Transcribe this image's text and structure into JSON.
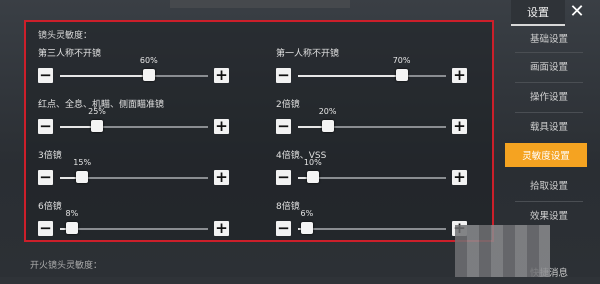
{
  "panel": {
    "title": "镜头灵敏度：",
    "settings": [
      {
        "label": "第三人称不开镜",
        "pct": "60%",
        "value": 60
      },
      {
        "label": "第一人称不开镜",
        "pct": "70%",
        "value": 70
      },
      {
        "label": "红点、全息、机瞄、侧面瞄准镜",
        "pct": "25%",
        "value": 25
      },
      {
        "label": "2倍镜",
        "pct": "20%",
        "value": 20
      },
      {
        "label": "3倍镜",
        "pct": "15%",
        "value": 15
      },
      {
        "label": "4倍镜、VSS",
        "pct": "10%",
        "value": 10
      },
      {
        "label": "6倍镜",
        "pct": "8%",
        "value": 8
      },
      {
        "label": "8倍镜",
        "pct": "6%",
        "value": 6
      }
    ]
  },
  "bottom_label": "开火镜头灵敏度：",
  "sidebar": {
    "title": "设置",
    "items": [
      "基础设置",
      "画面设置",
      "操作设置",
      "载具设置",
      "灵敏度设置",
      "拾取设置",
      "效果设置",
      "快捷消息"
    ],
    "active_index": 4
  }
}
